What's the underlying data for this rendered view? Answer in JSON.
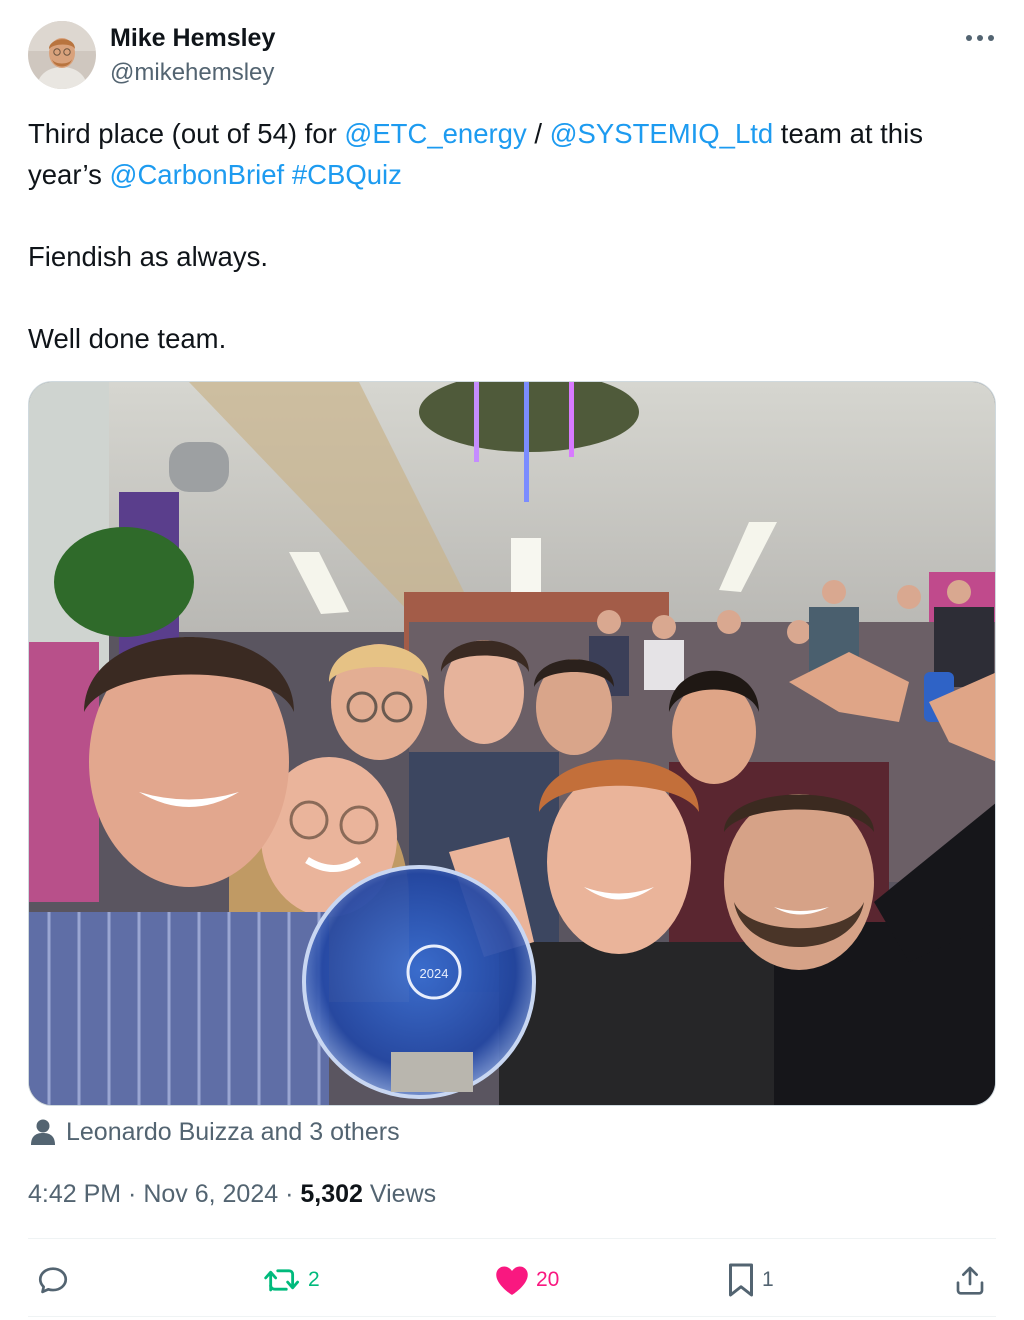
{
  "author": {
    "name": "Mike Hemsley",
    "handle": "@mikehemsley"
  },
  "tweet": {
    "line1": {
      "pre": "Third place (out of 54) for ",
      "mention1": "@ETC_energy",
      "sep": " / ",
      "mention2": "@SYSTEMIQ_Ltd",
      "post": " team at this"
    },
    "line2": {
      "pre": "year’s ",
      "mention": "@CarbonBrief",
      "space": " ",
      "hashtag": "#CBQuiz"
    },
    "para2": "Fiendish as always.",
    "para3": "Well done team."
  },
  "media": {
    "trophy_year": "2024"
  },
  "tagged": {
    "label": "Leonardo Buizza and 3 others",
    "icon": "person-icon"
  },
  "meta": {
    "time": "4:42 PM",
    "separator": " · ",
    "date": "Nov 6, 2024",
    "views_count": "5,302",
    "views_label": " Views"
  },
  "actions": {
    "reply": {
      "icon": "reply-icon",
      "count": ""
    },
    "retweet": {
      "icon": "retweet-icon",
      "count": "2",
      "color": "#00ba7c"
    },
    "like": {
      "icon": "heart-icon",
      "count": "20",
      "color": "#f91880"
    },
    "bookmark": {
      "icon": "bookmark-icon",
      "count": "1",
      "color": "#536471"
    },
    "share": {
      "icon": "share-icon",
      "count": ""
    }
  },
  "colors": {
    "link": "#1d9bf0",
    "secondary_text": "#536471",
    "primary_text": "#0f1419"
  }
}
